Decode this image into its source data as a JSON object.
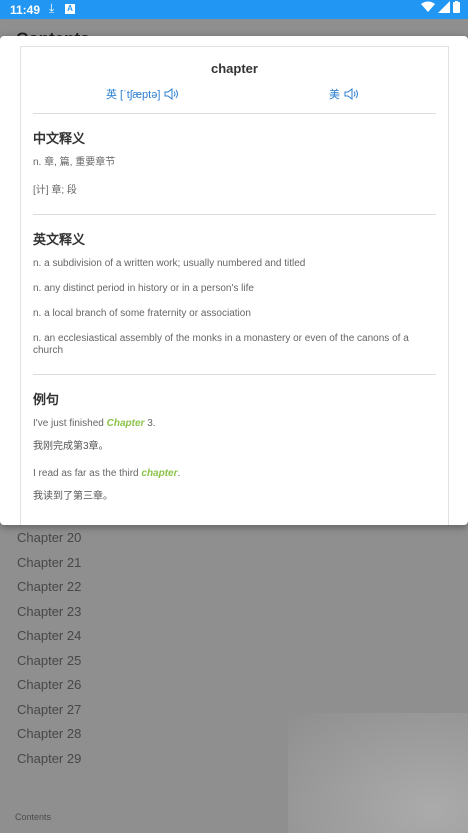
{
  "status_bar": {
    "time": "11:49"
  },
  "background": {
    "title": "Contents",
    "chapters": [
      "Chapter 20",
      "Chapter 21",
      "Chapter 22",
      "Chapter 23",
      "Chapter 24",
      "Chapter 25",
      "Chapter 26",
      "Chapter 27",
      "Chapter 28",
      "Chapter 29"
    ],
    "bottom_label": "Contents"
  },
  "dialog": {
    "word": "chapter",
    "uk_pronunciation": "英 [ˈtʃæptə]",
    "us_pronunciation": "美",
    "chinese_section": {
      "title": "中文释义",
      "definitions": [
        "n. 章, 篇, 重要章节",
        "[计] 章; 段"
      ]
    },
    "english_section": {
      "title": "英文释义",
      "definitions": [
        "n. a subdivision of a written work; usually numbered and titled",
        "n. any distinct period in history or in a person's life",
        "n. a local branch of some fraternity or association",
        "n. an ecclesiastical assembly of the monks in a monastery or even of the canons of a church"
      ]
    },
    "examples_section": {
      "title": "例句",
      "examples": [
        {
          "before": "I've just finished ",
          "highlight": "Chapter",
          "after": " 3.",
          "translation": "我刚完成第3章。"
        },
        {
          "before": "I read as far as the third ",
          "highlight": "chapter",
          "after": ".",
          "translation": "我读到了第三章。"
        }
      ]
    }
  },
  "colors": {
    "accent": "#2196f3",
    "highlight": "#8bc34a",
    "pron": "#2b7fd1"
  }
}
